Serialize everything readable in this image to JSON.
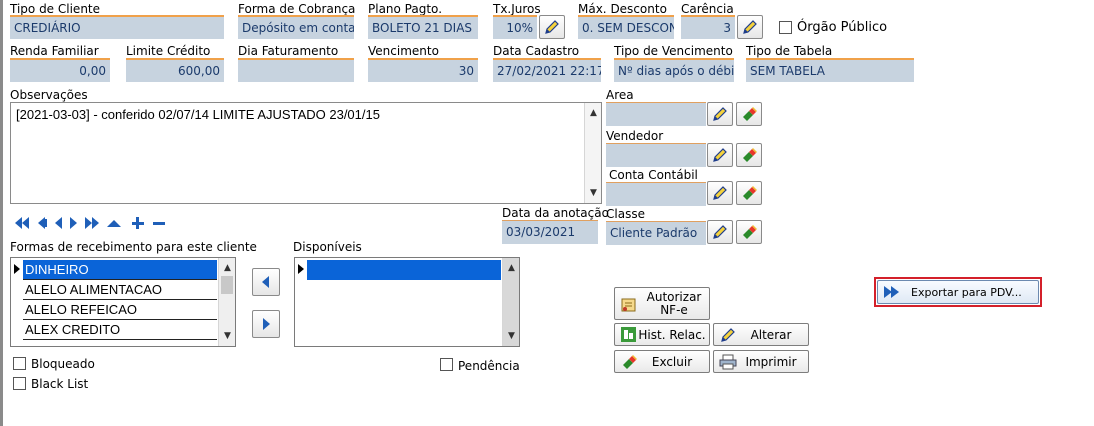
{
  "row1": {
    "tipo_cliente": {
      "label": "Tipo de Cliente",
      "value": "CREDIÁRIO"
    },
    "forma_cobranca": {
      "label": "Forma de Cobrança",
      "value": "Depósito em conta"
    },
    "plano_pagto": {
      "label": "Plano Pagto.",
      "value": "BOLETO 21 DIAS"
    },
    "tx_juros": {
      "label": "Tx.Juros",
      "value": "10%"
    },
    "max_desconto": {
      "label": "Máx. Desconto",
      "value": "0. SEM DESCON"
    },
    "carencia": {
      "label": "Carência",
      "value": "3"
    },
    "orgao_publico": {
      "label": "Órgão Público",
      "checked": false
    }
  },
  "row2": {
    "renda_familiar": {
      "label": "Renda Familiar",
      "value": "0,00"
    },
    "limite_credito": {
      "label": "Limite Crédito",
      "value": "600,00"
    },
    "dia_faturamento": {
      "label": "Dia Faturamento",
      "value": ""
    },
    "vencimento": {
      "label": "Vencimento",
      "value": "30"
    },
    "data_cadastro": {
      "label": "Data Cadastro",
      "value": "27/02/2021 22:17"
    },
    "tipo_vencimento": {
      "label": "Tipo de Vencimento",
      "value": "Nº dias após o débit"
    },
    "tipo_tabela": {
      "label": "Tipo de Tabela",
      "value": "SEM TABELA"
    }
  },
  "observacoes": {
    "label": "Observações",
    "text": "[2021-03-03] - conferido 02/07/14 LIMITE AJUSTADO 23/01/15"
  },
  "right_fields": {
    "area": {
      "label": "Area",
      "value": ""
    },
    "vendedor": {
      "label": "Vendedor",
      "value": ""
    },
    "conta_contabil": {
      "label": "Conta Contábil",
      "value": ""
    },
    "classe": {
      "label": "Classe",
      "value": "Cliente Padrão"
    }
  },
  "data_anotacao": {
    "label": "Data da anotação",
    "value": "03/03/2021"
  },
  "formas": {
    "label": "Formas de recebimento para este cliente",
    "items": [
      "DINHEIRO",
      "ALELO ALIMENTACAO",
      "ALELO REFEICAO",
      "ALEX CREDITO"
    ]
  },
  "disponiveis": {
    "label": "Disponíveis",
    "items": [
      ""
    ]
  },
  "checks": {
    "bloqueado": {
      "label": "Bloqueado",
      "checked": false
    },
    "black_list": {
      "label": "Black List",
      "checked": false
    },
    "pendencia": {
      "label": "Pendência",
      "checked": false
    }
  },
  "buttons": {
    "autorizar": "Autorizar\nNF-e",
    "hist_relac": "Hist. Relac.",
    "alterar": "Alterar",
    "excluir": "Excluir",
    "imprimir": "Imprimir",
    "exportar_pdv": "Exportar para PDV..."
  },
  "colors": {
    "field_bg": "#c7d3df",
    "field_border": "#f0a14a",
    "selection": "#0a64d8",
    "highlight_border": "#d4202a"
  }
}
